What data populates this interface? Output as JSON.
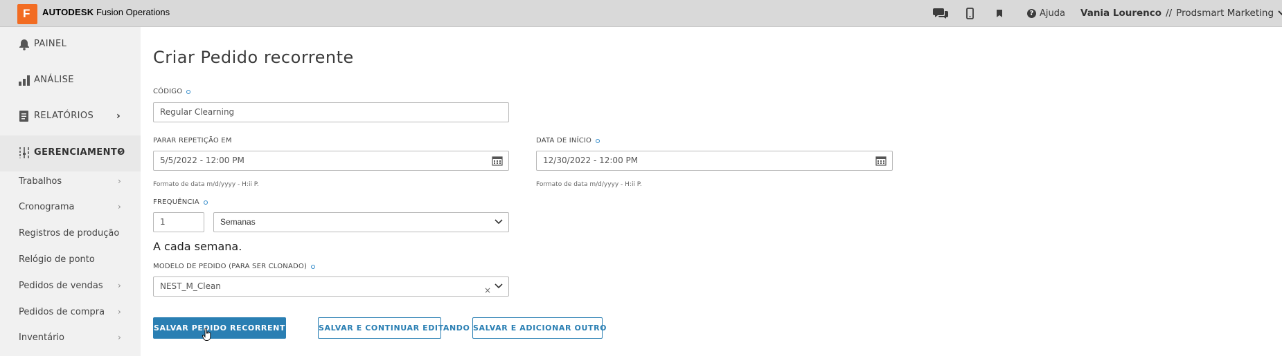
{
  "header": {
    "logo_letter": "F",
    "brand_bold": "AUTODESK",
    "brand_product": "Fusion Operations",
    "icons": [
      "chat-icon",
      "mobile-icon",
      "bookmark-icon"
    ],
    "help_label": "Ajuda",
    "user_name": "Vania Lourenco",
    "user_separator": "//",
    "company": "Prodsmart Marketing"
  },
  "sidebar": {
    "main_items": [
      {
        "label": "PAINEL",
        "icon": "bell-icon"
      },
      {
        "label": "ANÁLISE",
        "icon": "bar-chart-icon"
      },
      {
        "label": "RELATÓRIOS",
        "icon": "report-icon",
        "chevron": "›"
      },
      {
        "label": "GERENCIAMENTO",
        "icon": "sliders-icon",
        "chevron": "⌄"
      }
    ],
    "sub_items": [
      {
        "label": "Trabalhos",
        "chevron": "›"
      },
      {
        "label": "Cronograma",
        "chevron": "›"
      },
      {
        "label": "Registros de produção",
        "chevron": ""
      },
      {
        "label": "Relógio de ponto",
        "chevron": ""
      },
      {
        "label": "Pedidos de vendas",
        "chevron": "›"
      },
      {
        "label": "Pedidos de compra",
        "chevron": "›"
      },
      {
        "label": "Inventário",
        "chevron": "›"
      }
    ]
  },
  "form": {
    "title": "Criar Pedido recorrente",
    "code": {
      "label": "CÓDIGO",
      "value": "Regular Clearning"
    },
    "stop_repeat": {
      "label": "PARAR REPETIÇÃO EM",
      "value": "5/5/2022 - 12:00 PM",
      "hint": "Formato de data m/d/yyyy - H:ii P."
    },
    "start_date": {
      "label": "DATA DE INÍCIO",
      "value": "12/30/2022 - 12:00 PM",
      "hint": "Formato de data m/d/yyyy - H:ii P."
    },
    "frequency": {
      "label": "FREQUÊNCIA",
      "number": "1",
      "unit": "Semanas",
      "description": "A cada semana."
    },
    "template": {
      "label": "MODELO DE PEDIDO (PARA SER CLONADO)",
      "value": "NEST_M_Clean",
      "clear": "×"
    },
    "buttons": {
      "save": "SALVAR PEDIDO RECORRENTE",
      "save_continue": "SALVAR E CONTINUAR EDITANDO",
      "save_add": "SALVAR E ADICIONAR OUTRO"
    }
  },
  "colors": {
    "accent": "#2a7fb3",
    "logo": "#f26c22",
    "sidebar_bg": "#f1f1f1",
    "topbar_bg": "#d9d9d9"
  }
}
